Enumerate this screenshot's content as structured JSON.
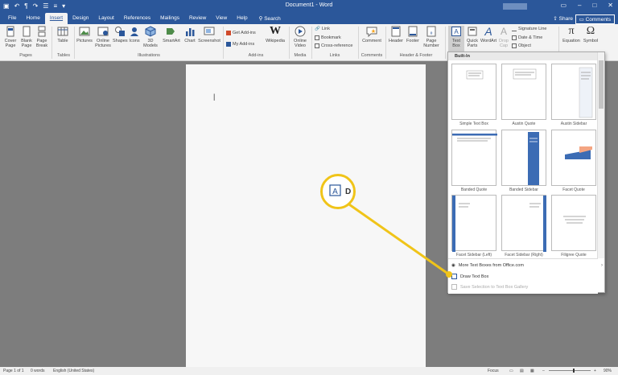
{
  "titlebar": {
    "doc_title": "Document1 - Word"
  },
  "tabs": [
    "File",
    "Home",
    "Insert",
    "Design",
    "Layout",
    "References",
    "Mailings",
    "Review",
    "View",
    "Help"
  ],
  "tell_me": "Search",
  "share": "Share",
  "comments": "Comments",
  "ribbon": {
    "cover_page": "Cover Page",
    "blank_page": "Blank Page",
    "page_break": "Page Break",
    "pages_group": "Pages",
    "table": "Table",
    "tables_group": "Tables",
    "pictures": "Pictures",
    "online_pictures": "Online Pictures",
    "shapes": "Shapes",
    "icons": "Icons",
    "models_3d": "3D Models",
    "smartart": "SmartArt",
    "chart": "Chart",
    "screenshot": "Screenshot",
    "illustrations_group": "Illustrations",
    "get_addins": "Get Add-ins",
    "my_addins": "My Add-ins",
    "wikipedia": "Wikipedia",
    "addins_group": "Add-ins",
    "online_video": "Online Video",
    "media_group": "Media",
    "link": "Link",
    "bookmark": "Bookmark",
    "cross_reference": "Cross-reference",
    "links_group": "Links",
    "comment": "Comment",
    "comments_group": "Comments",
    "header": "Header",
    "footer": "Footer",
    "page_number": "Page Number",
    "header_footer_group": "Header & Footer",
    "text_box": "Text Box",
    "quick_parts": "Quick Parts",
    "wordart": "WordArt",
    "drop_cap": "Drop Cap",
    "signature_line": "Signature Line",
    "date_time": "Date & Time",
    "object": "Object",
    "equation": "Equation",
    "symbol": "Symbol"
  },
  "gallery": {
    "header": "Built-In",
    "items": [
      "Simple Text Box",
      "Austin Quote",
      "Austin Sidebar",
      "Banded Quote",
      "Banded Sidebar",
      "Facet Quote",
      "Facet Sidebar (Left)",
      "Facet Sidebar (Right)",
      "Filigree Quote"
    ],
    "more": "More Text Boxes from Office.com",
    "draw": "Draw Text Box",
    "save": "Save Selection to Text Box Gallery"
  },
  "status": {
    "page": "Page 1 of 1",
    "words": "0 words",
    "language": "English (United States)",
    "focus": "Focus",
    "zoom": "90%"
  },
  "colors": {
    "brand": "#2b579a",
    "callout": "#f0c419",
    "text_box_blue": "#3c6cb4"
  }
}
